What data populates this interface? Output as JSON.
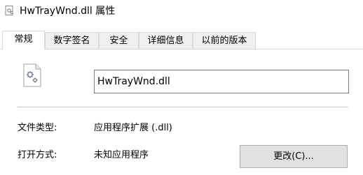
{
  "window": {
    "title": "HwTrayWnd.dll 属性",
    "title_icon": "file-properties-icon"
  },
  "tabs": [
    {
      "label": "常规",
      "active": true
    },
    {
      "label": "数字签名",
      "active": false
    },
    {
      "label": "安全",
      "active": false
    },
    {
      "label": "详细信息",
      "active": false
    },
    {
      "label": "以前的版本",
      "active": false
    }
  ],
  "general": {
    "file_icon": "dll-gear-file-icon",
    "file_name": "HwTrayWnd.dll",
    "file_type_label": "文件类型:",
    "file_type_value": "应用程序扩展 (.dll)",
    "open_with_label": "打开方式:",
    "open_with_value": "未知应用程序",
    "change_button": "更改(C)..."
  },
  "colors": {
    "tab_inactive_bg": "#f0f0f0",
    "border": "#d9d9d9",
    "button_bg": "#e1e1e1"
  }
}
